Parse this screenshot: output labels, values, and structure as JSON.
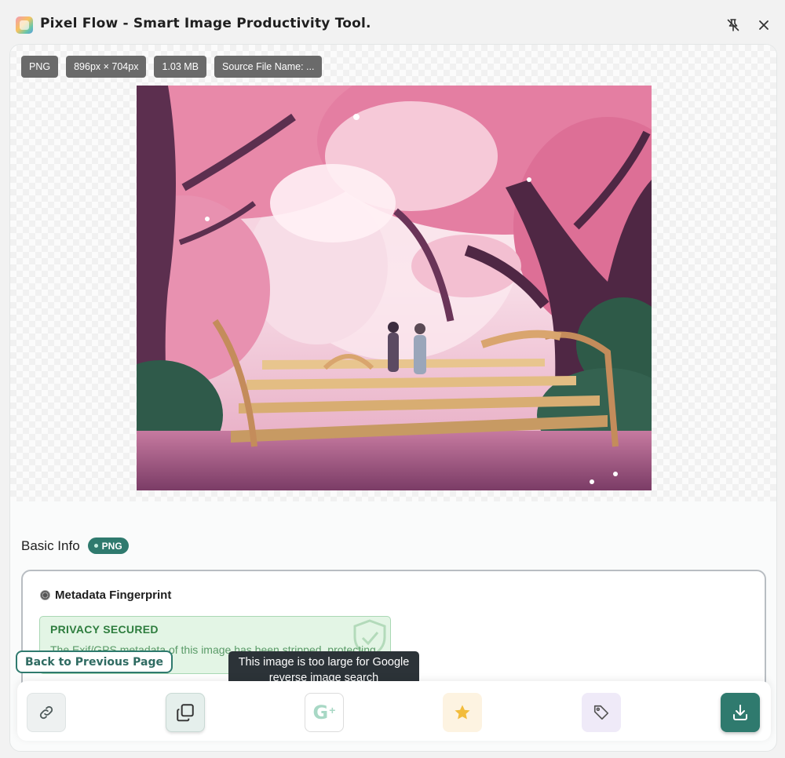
{
  "window": {
    "title": "Pixel Flow - Smart Image Productivity Tool.",
    "app_icon": "pixel-flow-logo",
    "buttons": {
      "pin_icon": "pin-off-icon",
      "close_icon": "close-icon"
    }
  },
  "image_meta": {
    "format": "PNG",
    "dimensions": "896px × 704px",
    "size": "1.03 MB",
    "source_name": "Source File Name: ..."
  },
  "basic_info": {
    "title": "Basic Info",
    "badge": "PNG"
  },
  "metadata": {
    "title": "Metadata Fingerprint",
    "privacy_title": "PRIVACY SECURED",
    "privacy_text": "The Exif/GPS metadata of this image has been stripped, protecting info"
  },
  "back_button": "Back to Previous Page",
  "tooltip": "This image is too large for Google reverse image search",
  "toolbar": {
    "google_label": "G",
    "google_plus": "+"
  },
  "colors": {
    "accent": "#2f7a6e",
    "privacy_bg": "#e3f5e5",
    "privacy_text": "#2e7d3e",
    "chip_bg": "#6a6a6a",
    "tooltip_bg": "#2c3338"
  }
}
